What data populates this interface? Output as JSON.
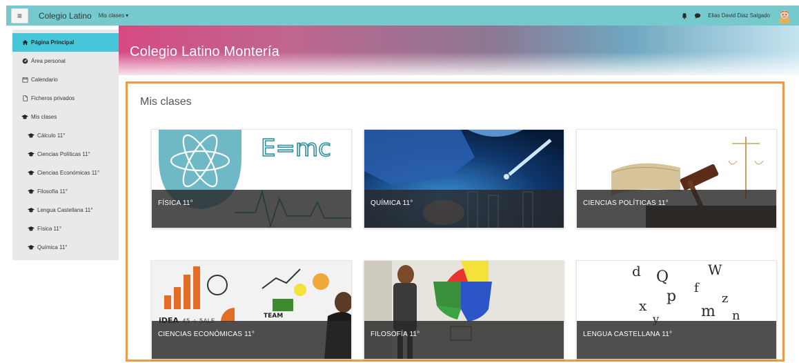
{
  "navbar": {
    "brand": "Colegio Latino",
    "nav_menu_label": "Mis clases",
    "user_name": "Elias David Diaz Salgado"
  },
  "sidebar": {
    "items": [
      {
        "label": "Página Principal",
        "icon": "home-icon",
        "active": true
      },
      {
        "label": "Área personal",
        "icon": "dashboard-icon"
      },
      {
        "label": "Calendario",
        "icon": "calendar-icon"
      },
      {
        "label": "Ficheros privados",
        "icon": "file-icon"
      },
      {
        "label": "Mis clases",
        "icon": "graduation-cap-icon"
      },
      {
        "label": "Cálculo 11°",
        "icon": "graduation-cap-icon"
      },
      {
        "label": "Ciencias Políticas 11°",
        "icon": "graduation-cap-icon"
      },
      {
        "label": "Ciencias Económicas 11°",
        "icon": "graduation-cap-icon"
      },
      {
        "label": "Filosofía 11°",
        "icon": "graduation-cap-icon"
      },
      {
        "label": "Lengua Castellana 11°",
        "icon": "graduation-cap-icon"
      },
      {
        "label": "Física 11°",
        "icon": "graduation-cap-icon"
      },
      {
        "label": "Química 11°",
        "icon": "graduation-cap-icon"
      }
    ]
  },
  "header": {
    "title": "Colegio Latino Montería"
  },
  "main": {
    "title": "Mis clases",
    "courses": [
      {
        "label": "FÍSICA 11°"
      },
      {
        "label": "QUÍMICA 11°"
      },
      {
        "label": "CIENCIAS POLÍTICAS 11°"
      },
      {
        "label": "CIENCIAS ECONÓMICAS 11°"
      },
      {
        "label": "FILOSOFÍA 11°"
      },
      {
        "label": "LENGUA CASTELLANA 11°"
      }
    ],
    "card_art_text": {
      "fisica_formula": "E=mc",
      "economicas_idea": "iDEA",
      "economicas_numbers": "45 ÷ 5ALE",
      "economicas_team": "TEAM",
      "lengua_letters": [
        "d",
        "Q",
        "W",
        "f",
        "p",
        "z",
        "x",
        "m",
        "n",
        "y"
      ]
    }
  },
  "colors": {
    "navbar": "#76c9cc",
    "sidebar_active": "#46c7d9",
    "panel_border": "#f19a45"
  }
}
